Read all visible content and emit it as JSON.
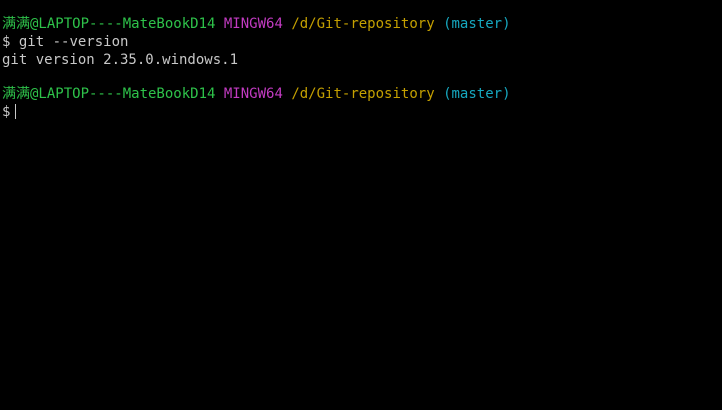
{
  "terminal": {
    "lines": [
      {
        "type": "prompt",
        "user": "满满@LAPTOP----MateBookD14",
        "env": "MINGW64",
        "path": "/d/Git-repository",
        "branch": "(master)"
      },
      {
        "type": "command",
        "symbol": "$",
        "text": "git --version"
      },
      {
        "type": "output",
        "text": "git version 2.35.0.windows.1"
      },
      {
        "type": "prompt",
        "user": "满满@LAPTOP----MateBookD14",
        "env": "MINGW64",
        "path": "/d/Git-repository",
        "branch": "(master)"
      },
      {
        "type": "command",
        "symbol": "$",
        "text": ""
      }
    ]
  },
  "colors": {
    "background": "#000000",
    "user": "#2ec24a",
    "env": "#c23bc2",
    "path": "#c4a000",
    "branch": "#16a8c0",
    "text": "#c8c8c8"
  }
}
